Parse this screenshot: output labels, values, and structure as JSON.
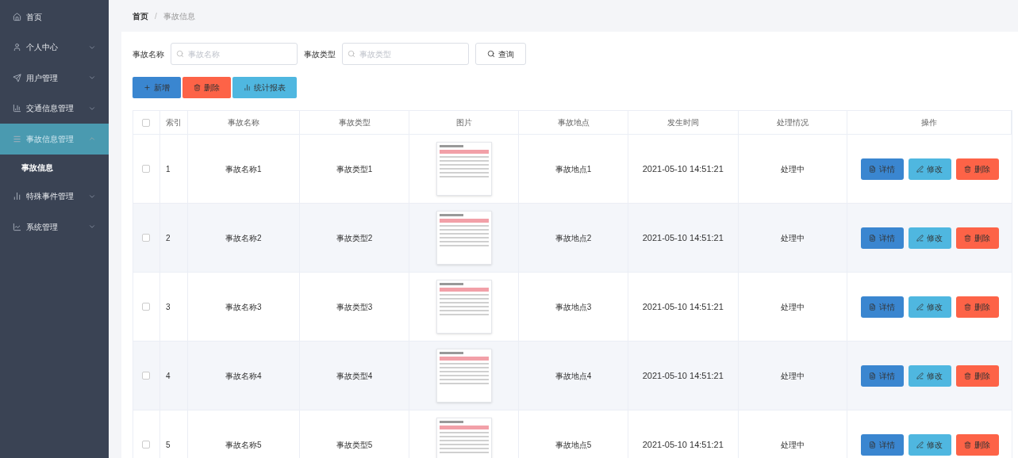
{
  "sidebar": {
    "items": [
      {
        "label": "首页",
        "selected": false
      },
      {
        "label": "个人中心",
        "selected": false,
        "expanded": false
      },
      {
        "label": "用户管理",
        "selected": false,
        "expanded": false
      },
      {
        "label": "交通信息管理",
        "selected": false,
        "expanded": false
      },
      {
        "label": "事故信息管理",
        "selected": true,
        "expanded": true,
        "children": [
          {
            "label": "事故信息",
            "selected": true
          }
        ]
      },
      {
        "label": "特殊事件管理",
        "selected": false,
        "expanded": false
      },
      {
        "label": "系统管理",
        "selected": false,
        "expanded": false
      }
    ]
  },
  "breadcrumb": {
    "items": [
      "首页",
      "事故信息"
    ],
    "separator": "/"
  },
  "search": {
    "fields": [
      {
        "label": "事故名称",
        "placeholder": "事故名称"
      },
      {
        "label": "事故类型",
        "placeholder": "事故类型"
      }
    ],
    "button": "查询"
  },
  "actions": [
    {
      "kind": "add",
      "label": "新增"
    },
    {
      "kind": "delete",
      "label": "删除"
    },
    {
      "kind": "report",
      "label": "统计报表"
    }
  ],
  "table": {
    "all_checked": false,
    "columns": [
      "索引",
      "事故名称",
      "事故类型",
      "图片",
      "事故地点",
      "发生时间",
      "处理情况",
      "操作"
    ],
    "rows": [
      {
        "checked": false,
        "index": "1",
        "name": "事故名称1",
        "type": "事故类型1",
        "place": "事故地点1",
        "time": "2021-05-10 14:51:21",
        "status": "处理中",
        "actions": [
          {
            "kind": "detail",
            "label": "详情"
          },
          {
            "kind": "edit",
            "label": "修改"
          },
          {
            "kind": "delete",
            "label": "删除"
          }
        ]
      },
      {
        "checked": false,
        "index": "2",
        "name": "事故名称2",
        "type": "事故类型2",
        "place": "事故地点2",
        "time": "2021-05-10 14:51:21",
        "status": "处理中",
        "actions": [
          {
            "kind": "detail",
            "label": "详情"
          },
          {
            "kind": "edit",
            "label": "修改"
          },
          {
            "kind": "delete",
            "label": "删除"
          }
        ]
      },
      {
        "checked": false,
        "index": "3",
        "name": "事故名称3",
        "type": "事故类型3",
        "place": "事故地点3",
        "time": "2021-05-10 14:51:21",
        "status": "处理中",
        "actions": [
          {
            "kind": "detail",
            "label": "详情"
          },
          {
            "kind": "edit",
            "label": "修改"
          },
          {
            "kind": "delete",
            "label": "删除"
          }
        ]
      },
      {
        "checked": false,
        "index": "4",
        "name": "事故名称4",
        "type": "事故类型4",
        "place": "事故地点4",
        "time": "2021-05-10 14:51:21",
        "status": "处理中",
        "actions": [
          {
            "kind": "detail",
            "label": "详情"
          },
          {
            "kind": "edit",
            "label": "修改"
          },
          {
            "kind": "delete",
            "label": "删除"
          }
        ]
      },
      {
        "checked": false,
        "index": "5",
        "name": "事故名称5",
        "type": "事故类型5",
        "place": "事故地点5",
        "time": "2021-05-10 14:51:21",
        "status": "处理中",
        "actions": [
          {
            "kind": "detail",
            "label": "详情"
          },
          {
            "kind": "edit",
            "label": "修改"
          },
          {
            "kind": "delete",
            "label": "删除"
          }
        ]
      }
    ]
  }
}
